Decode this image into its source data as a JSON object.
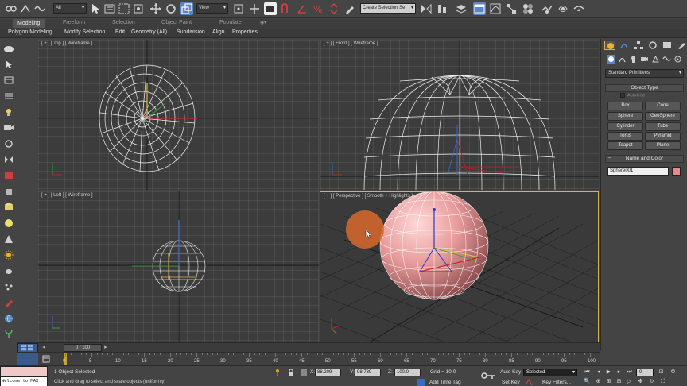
{
  "toolbar": {
    "filter_dropdown": "All",
    "reference_coord": "View",
    "named_selection": "Create Selection Se"
  },
  "ribbon": {
    "tabs": [
      "Modeling",
      "Freeform",
      "Selection",
      "Object Paint",
      "Populate"
    ],
    "menu": [
      "Polygon Modeling",
      "Modify Selection",
      "Edit",
      "Geometry (All)",
      "Subdivision",
      "Align",
      "Properties"
    ]
  },
  "viewports": {
    "top_label": "[ + ] [ Top ] [ Wireframe ]",
    "front_label": "[ + ] [ Front ] [ Wireframe ]",
    "left_label": "[ + ] [ Left ] [ Wireframe ]",
    "perspective_label": "[ + ] [ Perspective ] [ Smooth + Highlights ]"
  },
  "command_panel": {
    "category_dropdown": "Standard Primitives",
    "object_type_header": "Object Type",
    "autogrid_label": "AutoGrid",
    "primitives": [
      "Box",
      "Cone",
      "Sphere",
      "GeoSphere",
      "Cylinder",
      "Tube",
      "Torus",
      "Pyramid",
      "Teapot",
      "Plane"
    ],
    "name_color_header": "Name and Color",
    "object_name": "Sphere001",
    "object_color": "#e88888"
  },
  "timeline": {
    "slider_text": "0 / 100",
    "ticks": [
      "0",
      "5",
      "10",
      "15",
      "20",
      "25",
      "30",
      "35",
      "40",
      "45",
      "50",
      "55",
      "60",
      "65",
      "70",
      "75",
      "80",
      "85",
      "90",
      "95",
      "100"
    ]
  },
  "status": {
    "maxscript_text": "Welcome to MAX",
    "selection_status": "1 Object Selected",
    "prompt": "Click and drag to select and scale objects (uniformly)",
    "x_label": "X:",
    "x_value": "88.209",
    "y_label": "Y:",
    "y_value": "98.739",
    "z_label": "Z:",
    "z_value": "100.0",
    "grid": "Grid = 10.0",
    "add_time_tag": "Add Time Tag",
    "auto_key": "Auto Key",
    "auto_key_mode": "Selected",
    "set_key": "Set Key",
    "key_filters": "Key Filters...",
    "frame": "0"
  },
  "colors": {
    "accent": "#5a86c6",
    "selection_highlight": "#d8b24a",
    "cursor_circle": "#d9692b"
  }
}
